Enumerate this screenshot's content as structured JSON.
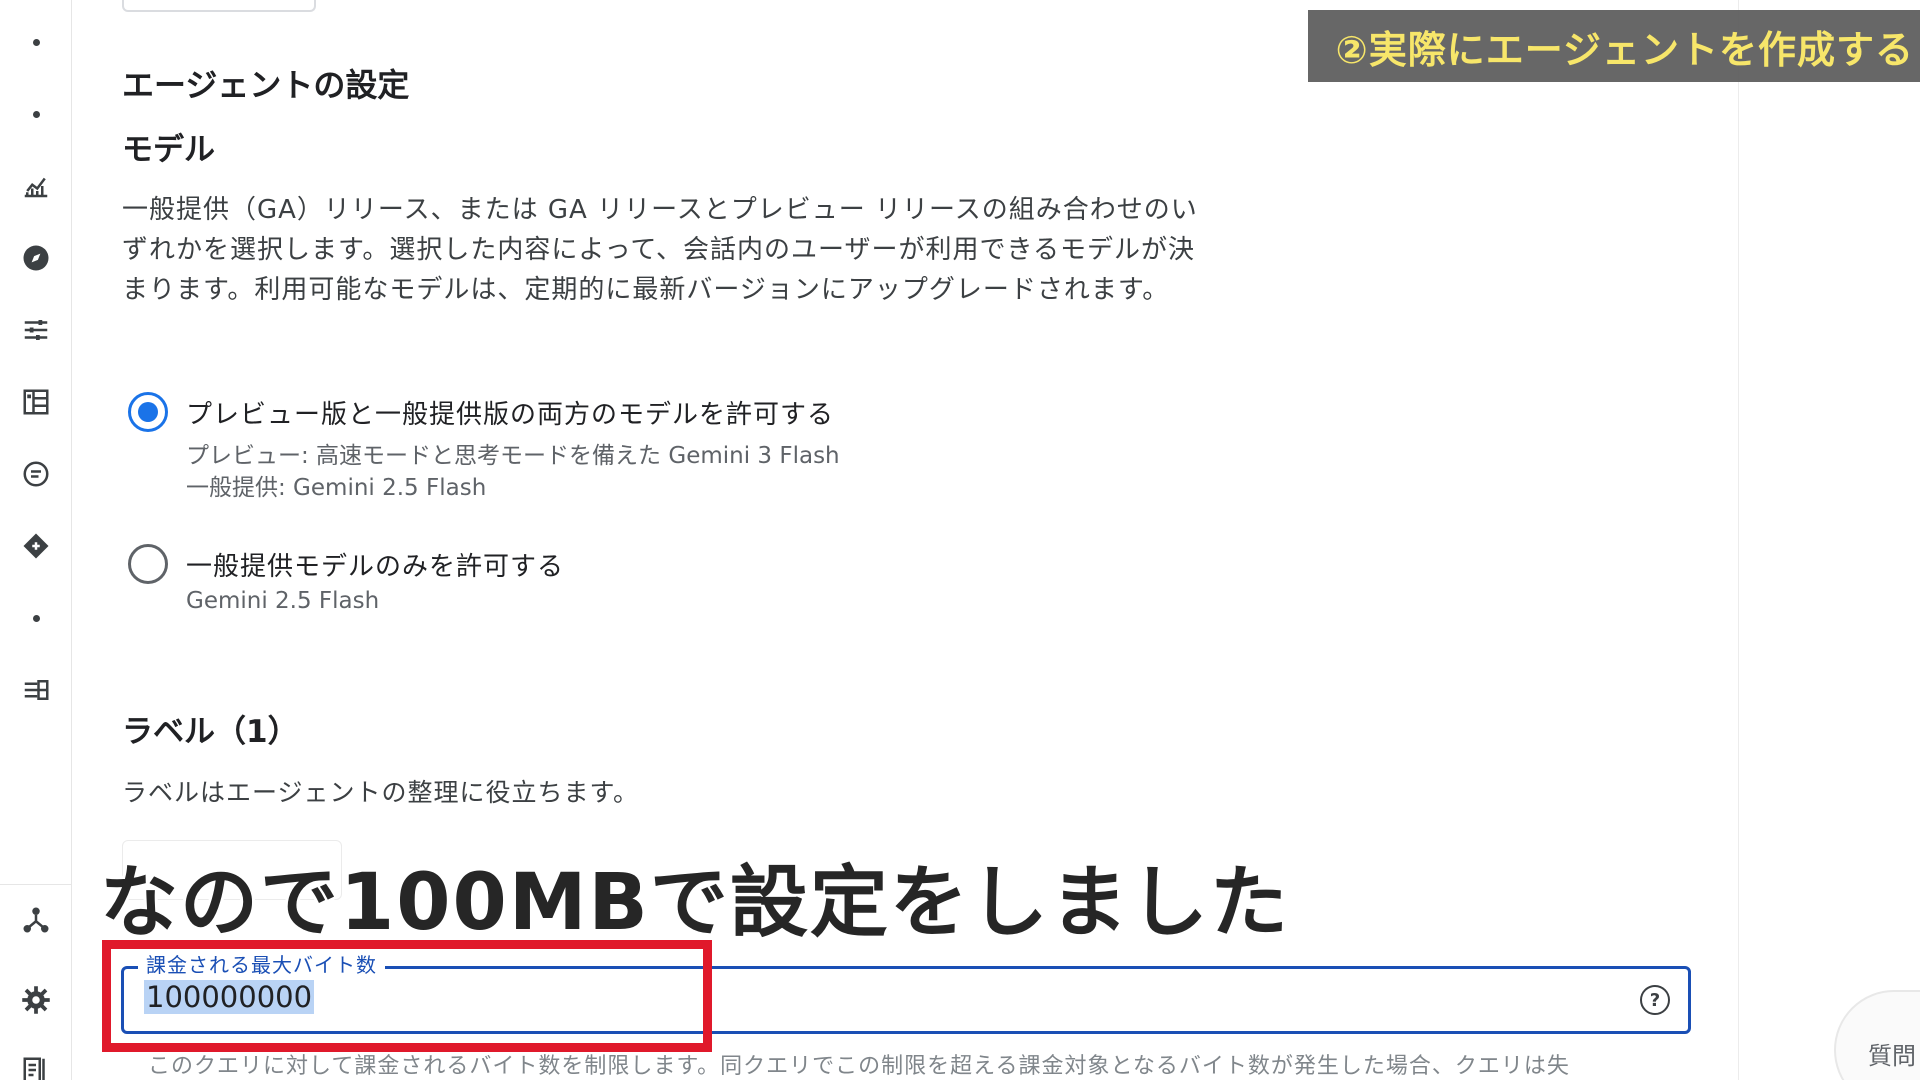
{
  "sidebar": {
    "items": [
      {
        "icon": "dot-icon"
      },
      {
        "icon": "dot-icon"
      },
      {
        "icon": "analytics-icon"
      },
      {
        "icon": "compass-icon"
      },
      {
        "icon": "tune-icon"
      },
      {
        "icon": "dashboard-icon"
      },
      {
        "icon": "chat-icon"
      },
      {
        "icon": "diamond-icon"
      },
      {
        "icon": "dot-icon"
      },
      {
        "icon": "pipeline-icon"
      },
      {
        "icon": "graph-icon"
      },
      {
        "icon": "gear-icon"
      },
      {
        "icon": "report-icon"
      }
    ]
  },
  "agent_settings": {
    "title": "エージェントの設定",
    "model_heading": "モデル",
    "model_description": "一般提供（GA）リリース、または GA リリースとプレビュー リリースの組み合わせのいずれかを選択します。選択した内容によって、会話内のユーザーが利用できるモデルが決まります。利用可能なモデルは、定期的に最新バージョンにアップグレードされます。",
    "options": [
      {
        "label": "プレビュー版と一般提供版の両方のモデルを許可する",
        "sub1": "プレビュー: 高速モードと思考モードを備えた Gemini 3 Flash",
        "sub2": "一般提供: Gemini 2.5 Flash",
        "selected": true
      },
      {
        "label": "一般提供モデルのみを許可する",
        "sub1": "Gemini 2.5 Flash",
        "selected": false
      }
    ],
    "labels_heading": "ラベル（1）",
    "labels_description": "ラベルはエージェントの整理に役立ちます。",
    "max_bytes_field": {
      "legend": "課金される最大バイト数",
      "value": "100000000",
      "hint": "このクエリに対して課金されるバイト数を制限します。同クエリでこの制限を超える課金対象となるバイト数が発生した場合、クエリは失"
    }
  },
  "ask_button_label": "質問",
  "overlay": {
    "step_banner": "②実際にエージェントを作成する",
    "subtitle": "なので100MBで設定をしました"
  },
  "colors": {
    "accent": "#1a73e8",
    "field_border": "#1a4fb5",
    "highlight_box": "#e0192b",
    "banner_text": "#f7e66a",
    "banner_bg": "#5f5f5f"
  }
}
